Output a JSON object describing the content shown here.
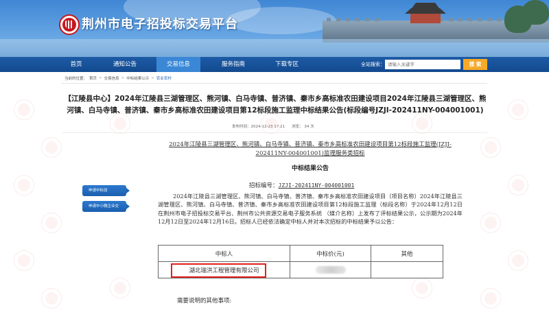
{
  "header": {
    "site_title": "荆州市电子招投标交易平台"
  },
  "nav": {
    "items": [
      {
        "label": "首页",
        "active": false
      },
      {
        "label": "通知公告",
        "active": false
      },
      {
        "label": "交易信息",
        "active": true
      },
      {
        "label": "服务指南",
        "active": false
      },
      {
        "label": "下载专区",
        "active": false
      }
    ],
    "search_label": "全站搜索：",
    "search_placeholder": "请输入关键字",
    "search_button": "搜 索"
  },
  "breadcrumb": {
    "prefix": "当前的位置：",
    "items": [
      "首页",
      "交易信息",
      "中标结果公示",
      "农业农村"
    ]
  },
  "announcement": {
    "title": "【江陵县中心】2024年江陵县三湖管理区、熊河镇、白马寺镇、普济镇、秦市乡高标准农田建设项目2024年江陵县三湖管理区、熊河镇、白马寺镇、普济镇、秦市乡高标准农田建设项目第12标段施工监理中标结果公告(标段编号JZJI-202411NY-004001001)",
    "publish_label": "发布时间：",
    "publish_time": "2024-12-23 17:21",
    "views_label": "浏览：",
    "views": "34",
    "views_unit": "次"
  },
  "document": {
    "heading": "2024年江陵县三湖管理区、熊河镇、白马寺镇、普济镇、秦市乡高标准农田建设项目第12标段施工监理(JZJI-202411NY-004001001)监理服务类招标",
    "subtitle": "中标结果公告",
    "tender_no_label": "招标编号：",
    "tender_no": "JZJI-202411NY-004001001",
    "paragraph": "2024年江陵县三湖管理区、熊河镇、白马寺镇、普济镇、秦市乡高标准农田建设项目（项目名称）2024年江陵县三湖管理区、熊河镇、白马寺镇、普济镇、秦市乡高标准农田建设项目第12标段施工监理（标段名称）于2024年12月12日在荆州市电子招投标交易平台、荆州市公共资源交易电子服务系统 （媒介名称）上发布了评标结果公示，公示期为2024年12月12日至2024年12月16日。招标人已经依法确定中标人并对本次招标的中标结果予以公告：",
    "table": {
      "headers": [
        "中标人",
        "中标价(元)",
        "其他"
      ],
      "rows": [
        {
          "winner": "湖北瑞洪工程管理有限公司",
          "price": "",
          "other": ""
        }
      ]
    },
    "more_notes": "需要说明的其他事项:"
  },
  "side_buttons": [
    "申请中标设",
    "申请中小微企业交"
  ],
  "colors": {
    "nav_bg": "#134a8e",
    "nav_active": "#3a87d6",
    "search_button": "#f7a928",
    "highlight_box": "#e0201c"
  }
}
